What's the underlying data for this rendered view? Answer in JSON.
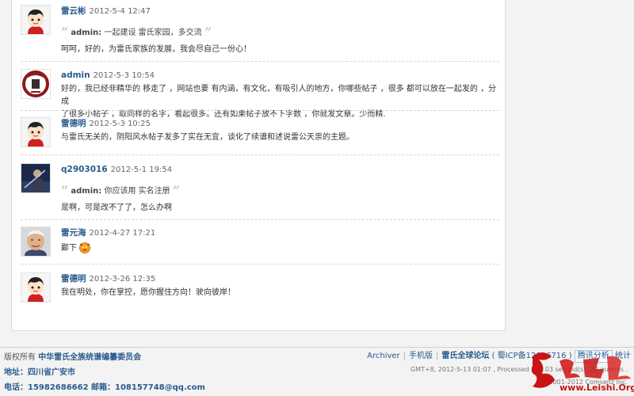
{
  "comments": [
    {
      "author": "雷云彬",
      "date": "2012-5-4 12:47",
      "avatar": "default-cartoon",
      "quote": {
        "author": "admin:",
        "text": "一起建设 雷氏家园，多交流"
      },
      "message": "呵呵，好的，为雷氏家族的发展，我会尽自己一份心！"
    },
    {
      "author": "admin",
      "date": "2012-5-3 10:54",
      "avatar": "clan-logo",
      "message_lines": [
        "好的，我已经非精华的 移走了 ，网站也要 有内涵，有文化，有吸引人的地方，你哪些帖子 ，很多 都可以放在一起发的 ，分成",
        "了很多小帖子 ，取同样的名字，看起很多。还有如果帖子放不下字数 ，你就发文章。少而精."
      ]
    },
    {
      "author": "雷德明",
      "date": "2012-5-3 10:25",
      "avatar": "default-cartoon",
      "message": "与雷氏无关的，阴阳风水帖子发多了实在无宜，谈化了续谱和述说雷公天祟的主题。"
    },
    {
      "author": "q2903016",
      "date": "2012-5-1 19:54",
      "avatar": "game-character",
      "quote": {
        "author": "admin:",
        "text": "你应该用 实名注册"
      },
      "message": "是啊，可是改不了了，怎么办啊"
    },
    {
      "author": "雷元海",
      "date": "2012-4-27 17:21",
      "avatar": "photo-man",
      "message": "鄙下",
      "emoji": "devil-smiley"
    },
    {
      "author": "雷德明",
      "date": "2012-3-26 12:35",
      "avatar": "default-cartoon",
      "message": "我在明处，你在掌控，愿你握住方向！驶向彼岸！"
    }
  ],
  "quote_mark_open": "“",
  "quote_mark_close": "”",
  "footer": {
    "owner_label": "版权所有",
    "owner": "中华雷氏全族统谱编纂委员会",
    "address": "地址：四川省广安市",
    "contact": "电话：15982686662 邮箱：108157748@qq.com",
    "links": [
      "Archiver",
      "手机版",
      "雷氏全球论坛"
    ],
    "icp": "( 蜀ICP备12016716 )",
    "analytics": "腾讯分析",
    "stats": "统计",
    "gmt_line": "GMT+8, 2012-5-13 01:07 , Processed in 0.03 second(s), 20 queries .",
    "copyright": "© 2001-2012 Comsenz Inc."
  },
  "logo": {
    "site": "www.Leishi.Org"
  },
  "colors": {
    "link": "#2a5b8e",
    "logo_red": "#c81414"
  }
}
